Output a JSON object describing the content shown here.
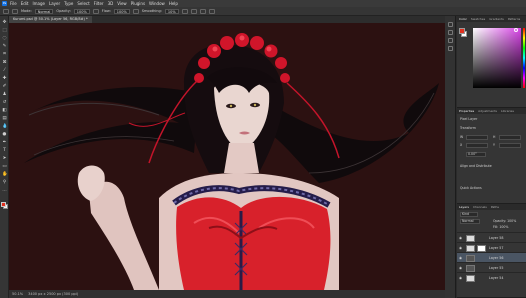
{
  "menubar": {
    "app_icon": "Ps",
    "items": [
      "File",
      "Edit",
      "Image",
      "Layer",
      "Type",
      "Select",
      "Filter",
      "3D",
      "View",
      "Plugins",
      "Window",
      "Help"
    ]
  },
  "options": {
    "mode_label": "Mode:",
    "mode_value": "Normal",
    "opacity_label": "Opacity:",
    "opacity_value": "100%",
    "flow_label": "Flow:",
    "flow_value": "100%",
    "smoothing_label": "Smoothing:",
    "smoothing_value": "10%"
  },
  "document": {
    "tab_title": "Kurumi.psd @ 50.1% (Layer 56, RGB/8#) *"
  },
  "status": {
    "zoom": "50.1%",
    "info": "3400 px x 2500 px (300 ppi)"
  },
  "color_panel": {
    "tabs": [
      "Color",
      "Swatches",
      "Gradients",
      "Patterns"
    ],
    "foreground": "#e0301e",
    "background": "#ffffff"
  },
  "properties_panel": {
    "tabs": [
      "Properties",
      "Adjustments",
      "Libraries"
    ],
    "section_pixel": "Pixel Layer",
    "section_transform": "Transform",
    "w_label": "W",
    "h_label": "H",
    "x_label": "X",
    "y_label": "Y",
    "angle_label": "0.00°",
    "align_label": "Align and Distribute",
    "quick_actions": "Quick Actions"
  },
  "layers_panel": {
    "tabs": [
      "Layers",
      "Channels",
      "Paths"
    ],
    "kind": "Kind",
    "blend": "Normal",
    "opacity": "Opacity: 100%",
    "fill": "Fill: 100%",
    "layers": [
      {
        "name": "Layer 58",
        "thumb": "light"
      },
      {
        "name": "Layer 57",
        "thumb": "light"
      },
      {
        "name": "Layer 56",
        "thumb": "dark"
      },
      {
        "name": "Layer 55",
        "thumb": "dark"
      },
      {
        "name": "Layer 54",
        "thumb": "light"
      }
    ]
  },
  "colors": {
    "canvas_bg": "#2c1111",
    "dress_red": "#d8212b",
    "accent_blue": "#1473e6"
  }
}
